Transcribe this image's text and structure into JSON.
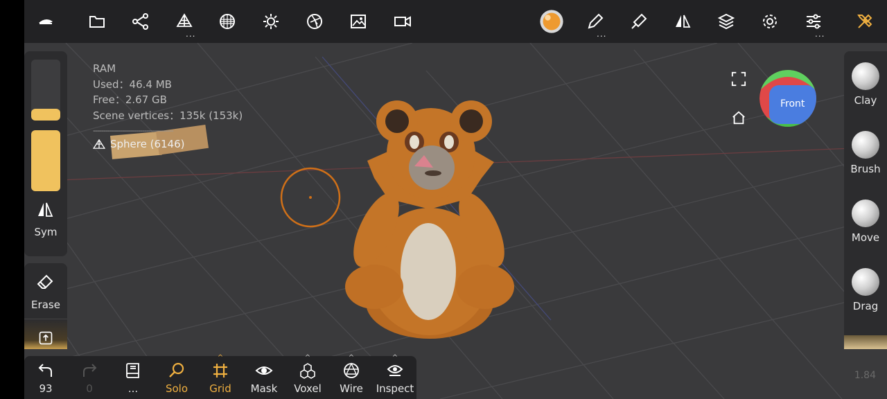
{
  "stats": {
    "ram": "RAM",
    "used": "Used：46.4 MB",
    "free": "Free：2.67 GB",
    "vertices": "Scene vertices：135k (153k)",
    "separator": "---------------------------------------",
    "mesh": "Sphere (6146)"
  },
  "left_panel": {
    "sym_label": "Sym",
    "erase_label": "Erase",
    "radius_fraction": 0.12,
    "intensity_fraction": 1.0
  },
  "right_tools": [
    {
      "label": "Clay"
    },
    {
      "label": "Brush"
    },
    {
      "label": "Move"
    },
    {
      "label": "Drag"
    }
  ],
  "bottom": {
    "undo_count": "93",
    "redo_count": "0",
    "scene_dots": "...",
    "solo": "Solo",
    "grid": "Grid",
    "mask": "Mask",
    "voxel": "Voxel",
    "wire": "Wire",
    "inspect": "Inspect"
  },
  "nav_cube": {
    "face": "Front"
  },
  "version": "1.84",
  "colors": {
    "accent": "#f0b040",
    "slider": "#f0c25e"
  }
}
